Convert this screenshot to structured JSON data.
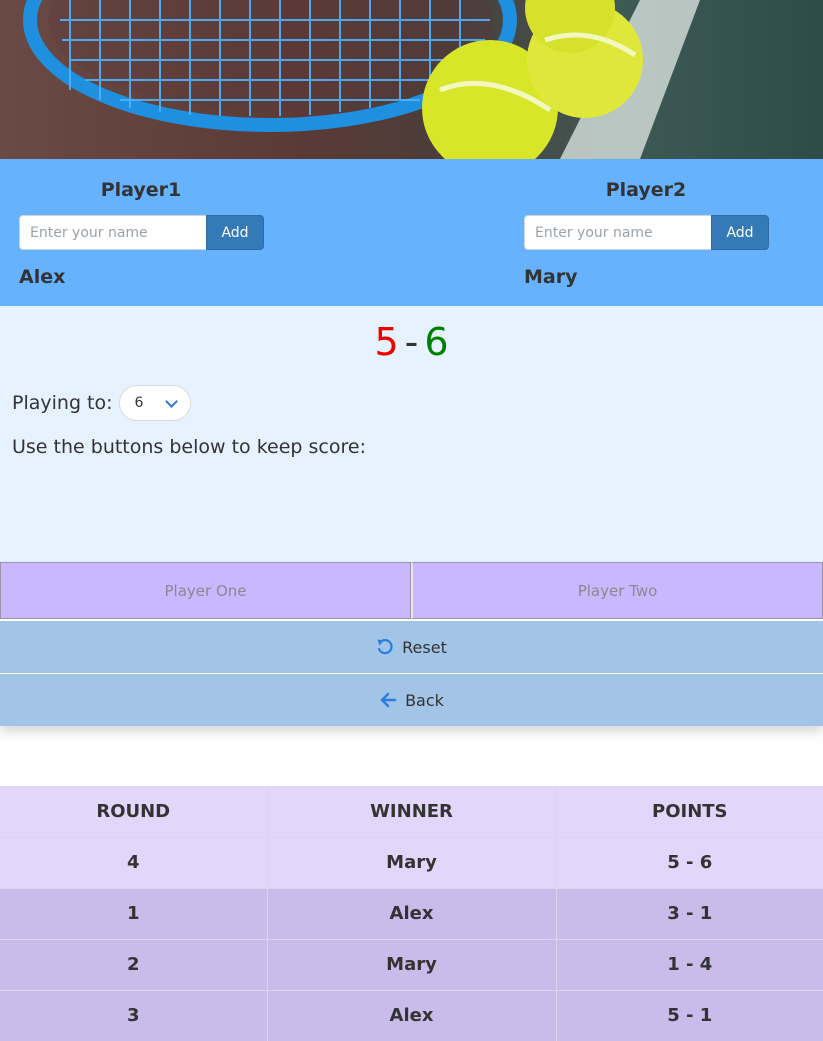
{
  "players": [
    {
      "title": "Player1",
      "placeholder": "Enter your name",
      "add_label": "Add",
      "name": "Alex"
    },
    {
      "title": "Player2",
      "placeholder": "Enter your name",
      "add_label": "Add",
      "name": "Mary"
    }
  ],
  "score": {
    "player1": "5",
    "separator": "-",
    "player2": "6"
  },
  "playing_to": {
    "label": "Playing to:",
    "value": "6"
  },
  "hint": "Use the buttons below to keep score:",
  "buttons": {
    "player_one": "Player One",
    "player_two": "Player Two",
    "reset": "Reset",
    "back": "Back"
  },
  "table": {
    "headers": [
      "ROUND",
      "WINNER",
      "POINTS"
    ],
    "rows": [
      [
        "4",
        "Mary",
        "5 - 6"
      ],
      [
        "1",
        "Alex",
        "3 - 1"
      ],
      [
        "2",
        "Mary",
        "1 - 4"
      ],
      [
        "3",
        "Alex",
        "5 - 1"
      ]
    ]
  },
  "colors": {
    "player1_score": "#ee0000",
    "player2_score": "#008000",
    "players_panel": "#66b2ff",
    "add_button": "#337ab7"
  },
  "icons": {
    "reset": "rotate-left-icon",
    "back": "arrow-left-icon"
  }
}
